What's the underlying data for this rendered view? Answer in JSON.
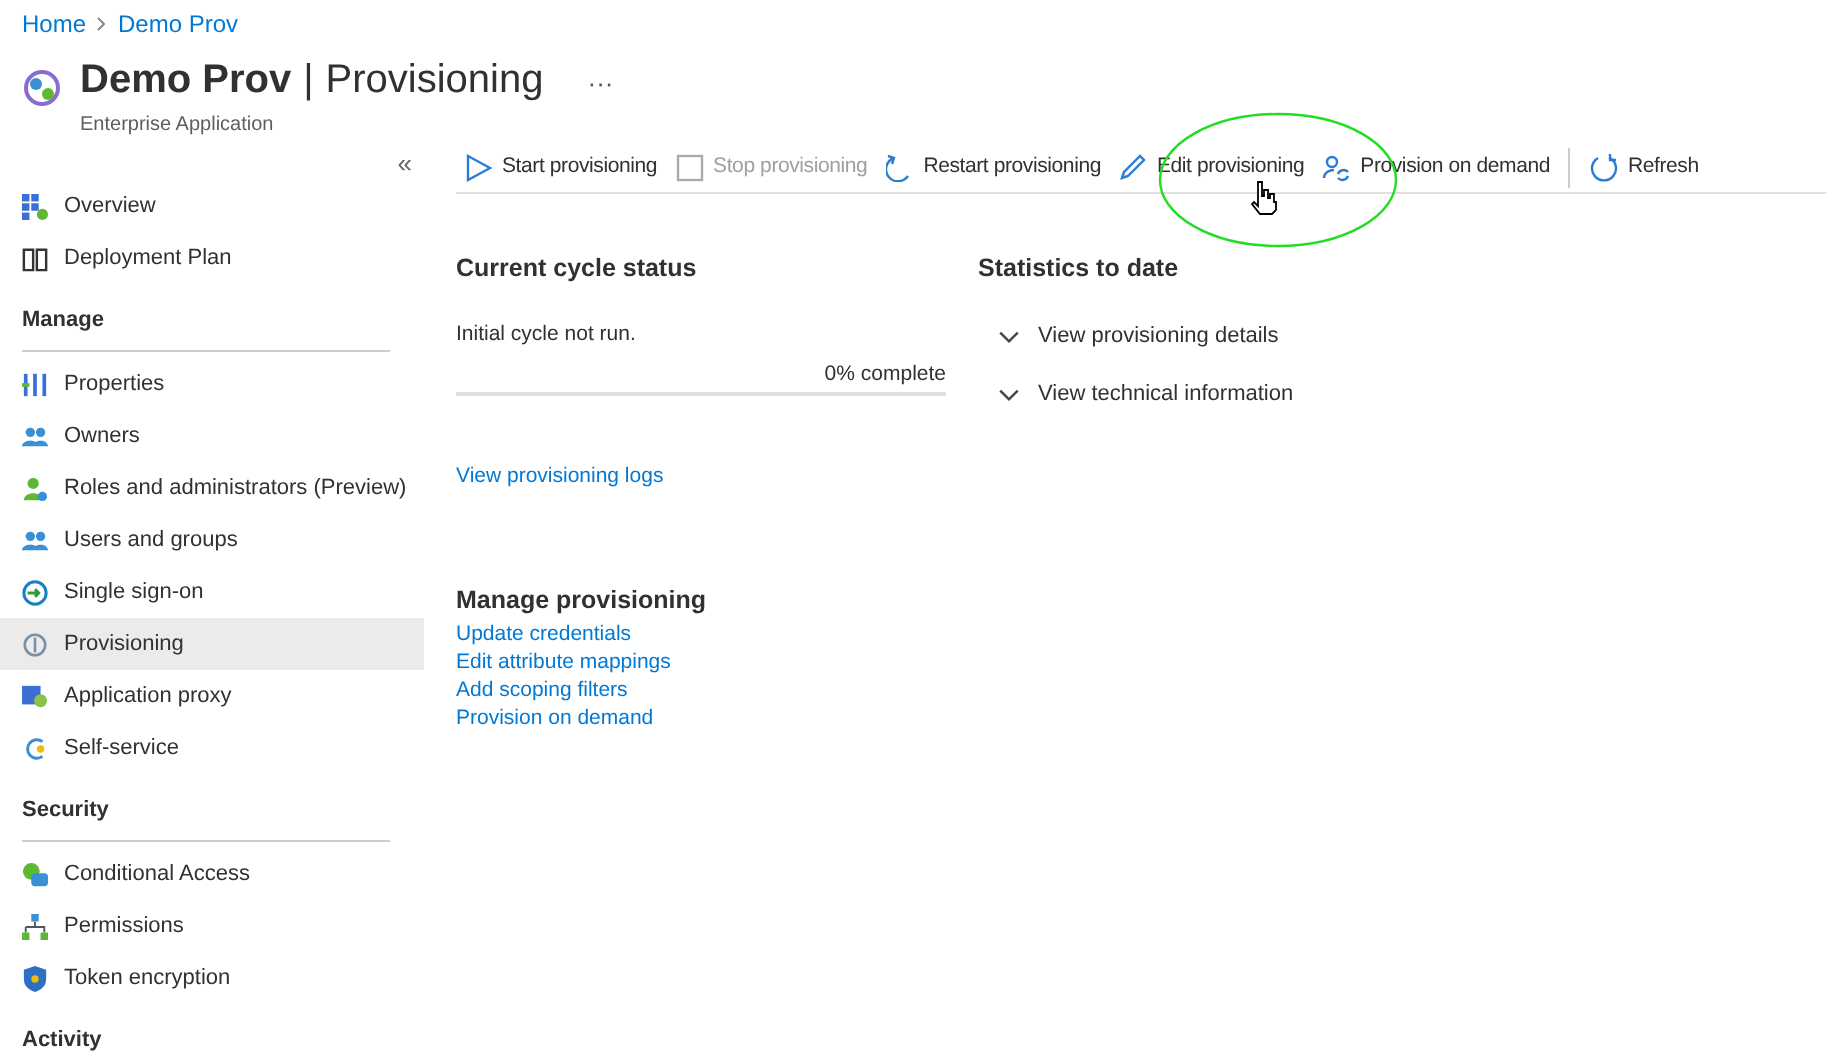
{
  "breadcrumb": [
    "Home",
    "Demo Prov"
  ],
  "header": {
    "app_name": "Demo Prov",
    "separator": "|",
    "page": "Provisioning",
    "more": "···",
    "subtitle": "Enterprise Application"
  },
  "sidebar": {
    "collapse": "«",
    "sections": [
      {
        "items": [
          {
            "label": "Overview",
            "kind": "grid",
            "selected": false
          },
          {
            "label": "Deployment Plan",
            "kind": "book",
            "selected": false
          }
        ]
      },
      {
        "heading": "Manage",
        "items": [
          {
            "label": "Properties",
            "kind": "bars",
            "selected": false
          },
          {
            "label": "Owners",
            "kind": "people",
            "selected": false
          },
          {
            "label": "Roles and administrators (Preview)",
            "kind": "person",
            "selected": false
          },
          {
            "label": "Users and groups",
            "kind": "people",
            "selected": false
          },
          {
            "label": "Single sign-on",
            "kind": "signin",
            "selected": false
          },
          {
            "label": "Provisioning",
            "kind": "sync",
            "selected": true
          },
          {
            "label": "Application proxy",
            "kind": "proxy",
            "selected": false
          },
          {
            "label": "Self-service",
            "kind": "selfservice",
            "selected": false
          }
        ]
      },
      {
        "heading": "Security",
        "items": [
          {
            "label": "Conditional Access",
            "kind": "chat",
            "selected": false
          },
          {
            "label": "Permissions",
            "kind": "hierarchy",
            "selected": false
          },
          {
            "label": "Token encryption",
            "kind": "shield",
            "selected": false
          }
        ]
      },
      {
        "heading": "Activity"
      }
    ]
  },
  "toolbar": [
    {
      "label": "Start provisioning",
      "kind": "play",
      "disabled": false,
      "divider_before": false
    },
    {
      "label": "Stop provisioning",
      "kind": "stop",
      "disabled": true,
      "divider_before": false
    },
    {
      "label": "Restart provisioning",
      "kind": "restart",
      "disabled": false,
      "divider_before": false
    },
    {
      "label": "Edit provisioning",
      "kind": "pencil",
      "disabled": false,
      "divider_before": false,
      "highlighted": true
    },
    {
      "label": "Provision on demand",
      "kind": "personsync",
      "disabled": false,
      "divider_before": false
    },
    {
      "label": "Refresh",
      "kind": "refresh",
      "disabled": false,
      "divider_before": true
    }
  ],
  "current_cycle": {
    "title": "Current cycle status",
    "status": "Initial cycle not run.",
    "progress_label": "0% complete",
    "level": 0,
    "logs_link": "View provisioning logs"
  },
  "statistics": {
    "title": "Statistics to date",
    "items": [
      {
        "label": "View provisioning details",
        "expanded": false
      },
      {
        "label": "View technical information",
        "expanded": false
      }
    ]
  },
  "manage_provisioning": {
    "title": "Manage provisioning",
    "links": [
      "Update credentials",
      "Edit attribute mappings",
      "Add scoping filters",
      "Provision on demand"
    ]
  }
}
